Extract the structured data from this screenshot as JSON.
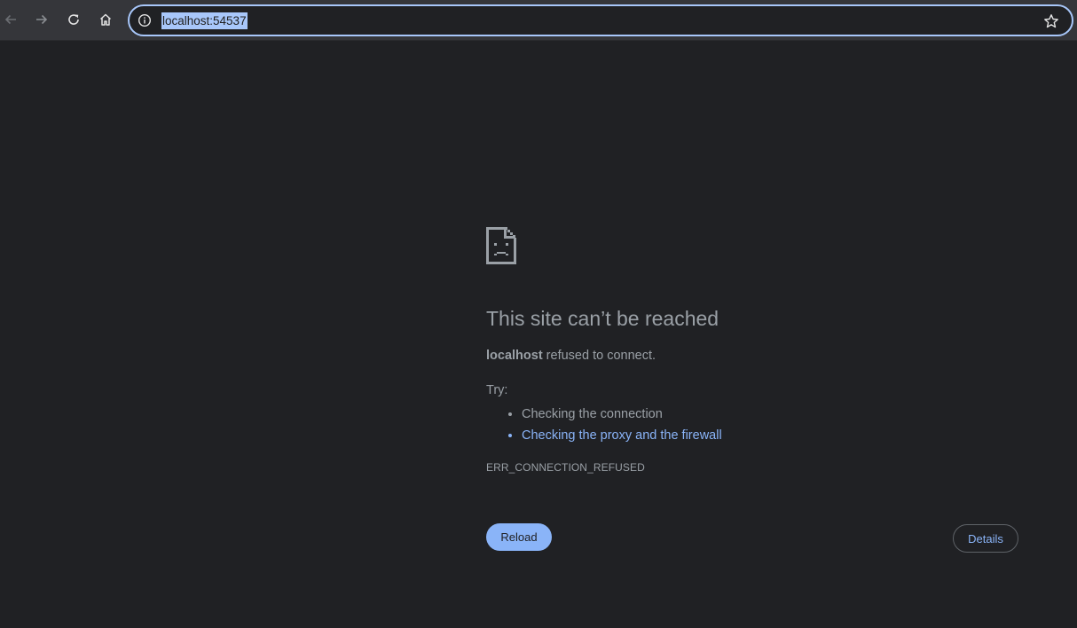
{
  "toolbar": {
    "icons": {
      "back": "arrow-left-icon",
      "forward": "arrow-right-icon",
      "reload": "reload-icon",
      "home": "home-icon",
      "info": "info-icon",
      "bookmark": "star-icon"
    },
    "url": "localhost:54537",
    "colors": {
      "toolbar_bg": "#35363a",
      "omnibox_border": "#a8c7fa",
      "url_highlight": "#a8c7fa"
    }
  },
  "error_page": {
    "icon": "sad-page-icon",
    "title": "This site can’t be reached",
    "detail_host": "localhost",
    "detail_text": " refused to connect.",
    "try_label": "Try:",
    "suggestions": [
      "Checking the connection",
      "Checking the proxy and the firewall"
    ],
    "error_code": "ERR_CONNECTION_REFUSED",
    "reload_label": "Reload",
    "details_label": "Details",
    "colors": {
      "page_bg": "#202124",
      "text": "#9aa0a6",
      "link": "#8ab4f8",
      "primary_button": "#8ab4f8"
    }
  }
}
